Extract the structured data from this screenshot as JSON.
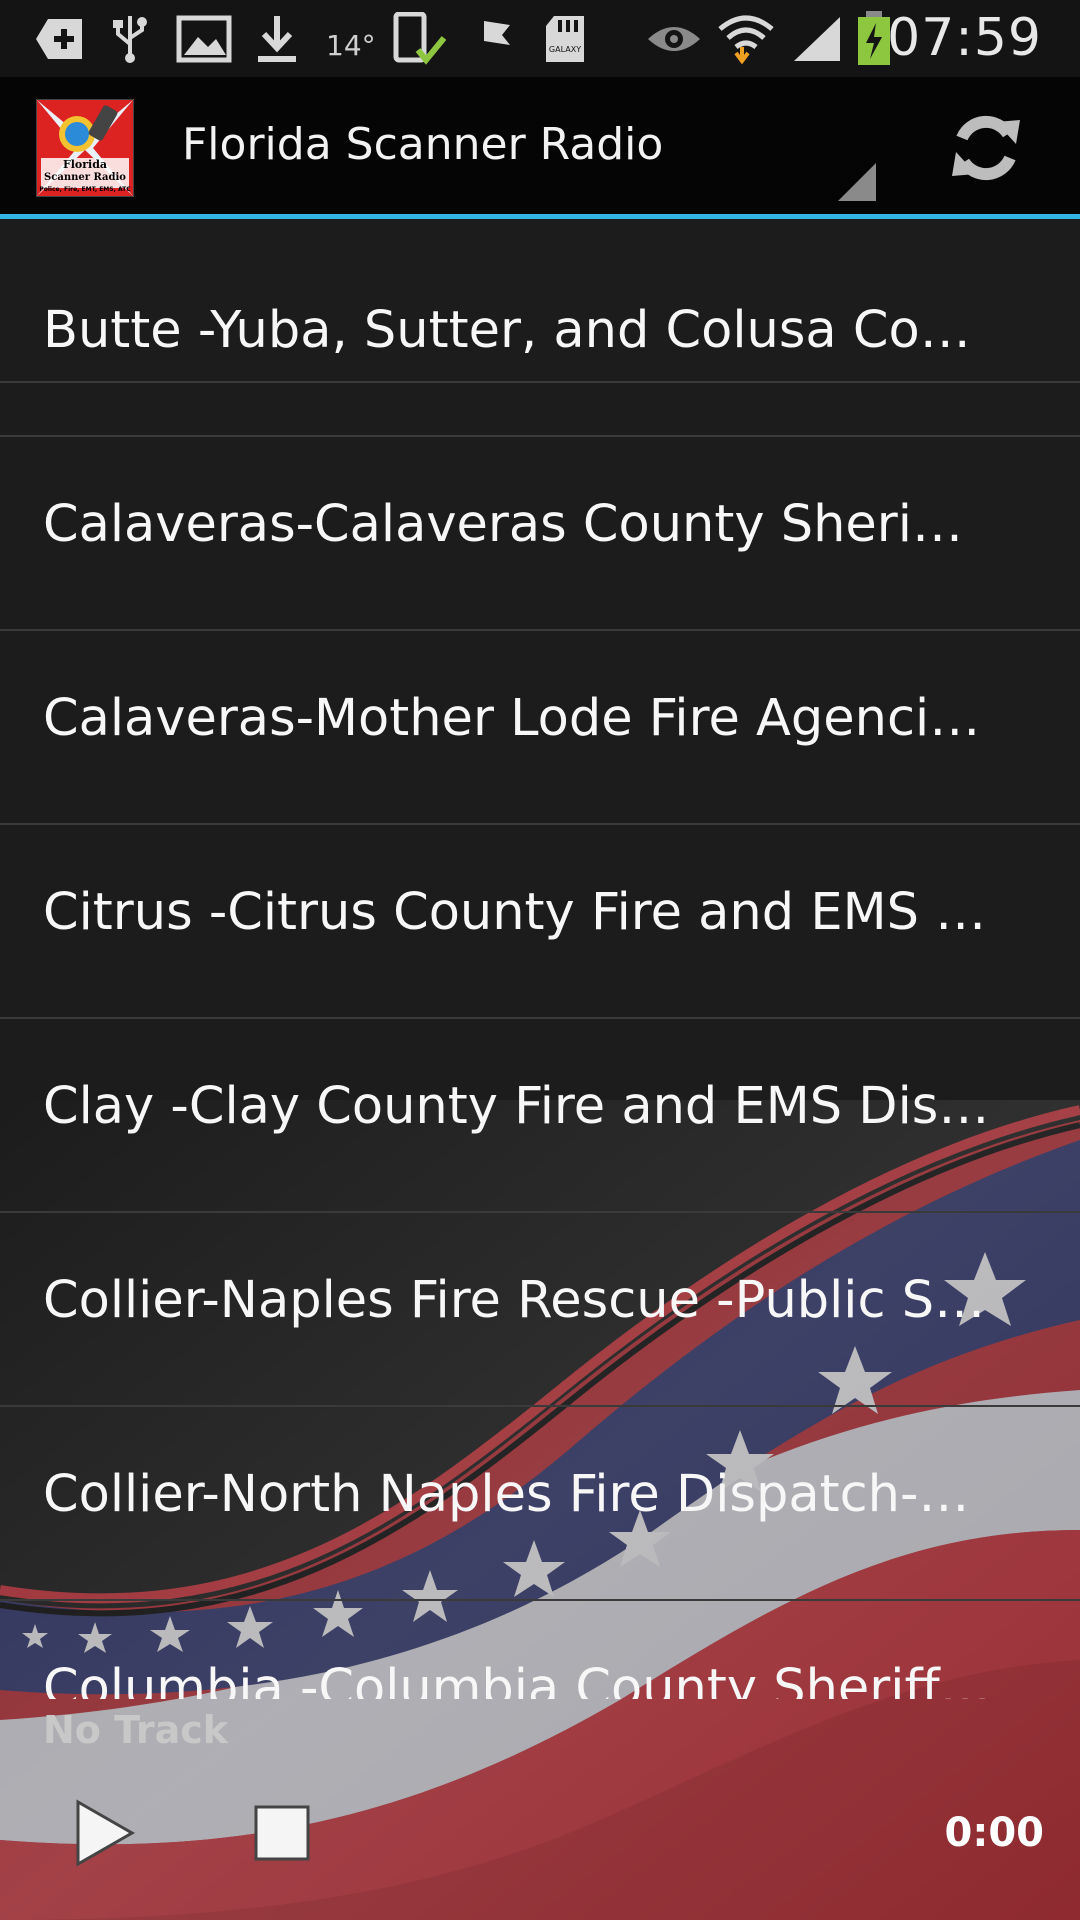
{
  "status_bar": {
    "icons": [
      "add-icon",
      "usb-icon",
      "image-icon",
      "download-icon",
      "temperature-icon",
      "phone-check-icon",
      "flag-icon",
      "sd-card-icon",
      "eye-icon",
      "wifi-icon",
      "signal-icon",
      "battery-charging-icon"
    ],
    "temperature": "14°",
    "sd_card_label": "GALAXY",
    "time": "07:59"
  },
  "action_bar": {
    "title": "Florida Scanner Radio",
    "logo_text": "Florida Scanner Radio",
    "logo_subtext": "Police, Fire, EMT, EMS, ATC",
    "refresh_icon": "refresh-icon",
    "accent_color": "#33b5e5"
  },
  "list": {
    "items": [
      "Butte -Yuba, Sutter, and Colusa Counties",
      "Calaveras-Calaveras County Sheriff, County Fire",
      "Calaveras-Mother Lode Fire Agencies -Public Safety",
      "Citrus -Citrus County Fire and EMS -Public Safety",
      "Clay -Clay County Fire and EMS Dispatch",
      "Collier-Naples Fire Rescue -Public Safety",
      "Collier-North Naples Fire Dispatch-Public Safety",
      "Columbia -Columbia County Sheriff, Fire"
    ]
  },
  "player": {
    "track": "No Track",
    "elapsed": "0:00",
    "play_icon": "play-icon",
    "stop_icon": "stop-icon"
  }
}
